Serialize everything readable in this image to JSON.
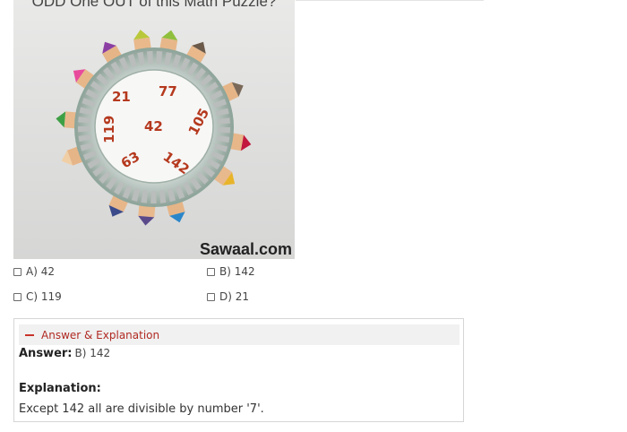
{
  "puzzle": {
    "title": "ODD One OUT of this Math Puzzle?",
    "brand": "Sawaal.com",
    "numbers": [
      "21",
      "77",
      "119",
      "42",
      "105",
      "63",
      "142"
    ]
  },
  "options": [
    {
      "label": "A) 42"
    },
    {
      "label": "B) 142"
    },
    {
      "label": "C) 119"
    },
    {
      "label": "D) 21"
    }
  ],
  "answer_panel": {
    "toggle_label": "Answer & Explanation",
    "answer_label": "Answer:",
    "answer_value": "B) 142",
    "explanation_label": "Explanation:",
    "explanation_text": "Except 142 all are divisible by number '7'."
  },
  "colors": {
    "accent_red": "#b02a23",
    "number_color": "#b5391e"
  }
}
